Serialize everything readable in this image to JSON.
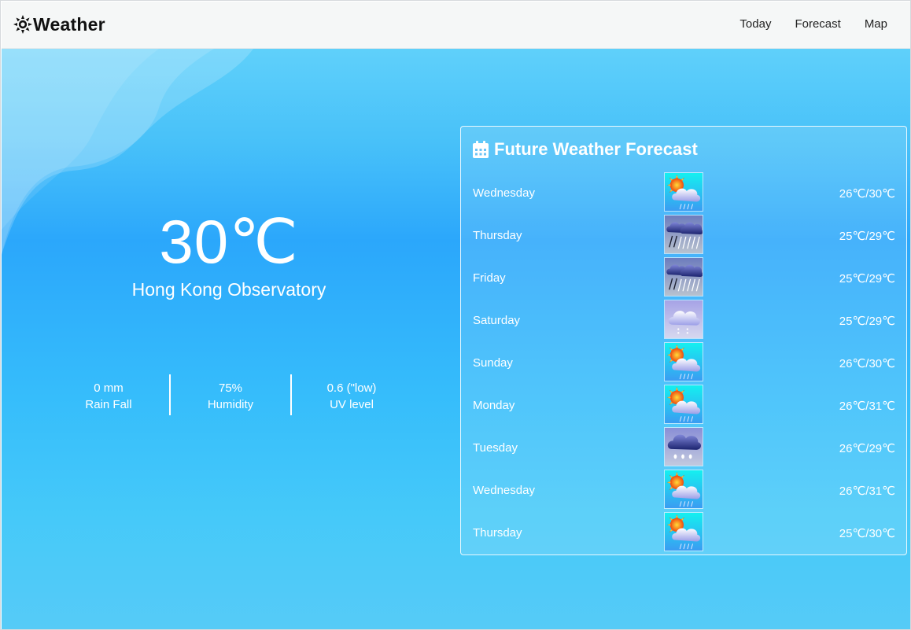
{
  "navbar": {
    "brand": "Weather",
    "links": [
      "Today",
      "Forecast",
      "Map"
    ]
  },
  "current": {
    "temperature": "30℃",
    "station": "Hong Kong Observatory",
    "stats": [
      {
        "value": "0 mm",
        "label": "Rain Fall"
      },
      {
        "value": "75%",
        "label": "Humidity"
      },
      {
        "value": "0.6 (\"low)",
        "label": "UV level"
      }
    ]
  },
  "forecast": {
    "title": "Future Weather Forecast",
    "days": [
      {
        "day": "Wednesday",
        "temp": "26℃/30℃",
        "icon": "sun-cloud-rain-icon"
      },
      {
        "day": "Thursday",
        "temp": "25℃/29℃",
        "icon": "heavy-rain-icon"
      },
      {
        "day": "Friday",
        "temp": "25℃/29℃",
        "icon": "heavy-rain-icon"
      },
      {
        "day": "Saturday",
        "temp": "25℃/29℃",
        "icon": "light-rain-icon"
      },
      {
        "day": "Sunday",
        "temp": "26℃/30℃",
        "icon": "sun-cloud-rain-icon"
      },
      {
        "day": "Monday",
        "temp": "26℃/31℃",
        "icon": "sun-cloud-rain-icon"
      },
      {
        "day": "Tuesday",
        "temp": "26℃/29℃",
        "icon": "dark-cloud-rain-icon"
      },
      {
        "day": "Wednesday",
        "temp": "26℃/31℃",
        "icon": "sun-cloud-rain-icon"
      },
      {
        "day": "Thursday",
        "temp": "25℃/30℃",
        "icon": "sun-cloud-rain-icon"
      }
    ]
  },
  "colors": {
    "sky_top": "#5fd0fa",
    "sky_mid": "#2ba7fb",
    "sky_bottom": "#56cbf7",
    "navbar_bg": "#f5f7f7"
  }
}
